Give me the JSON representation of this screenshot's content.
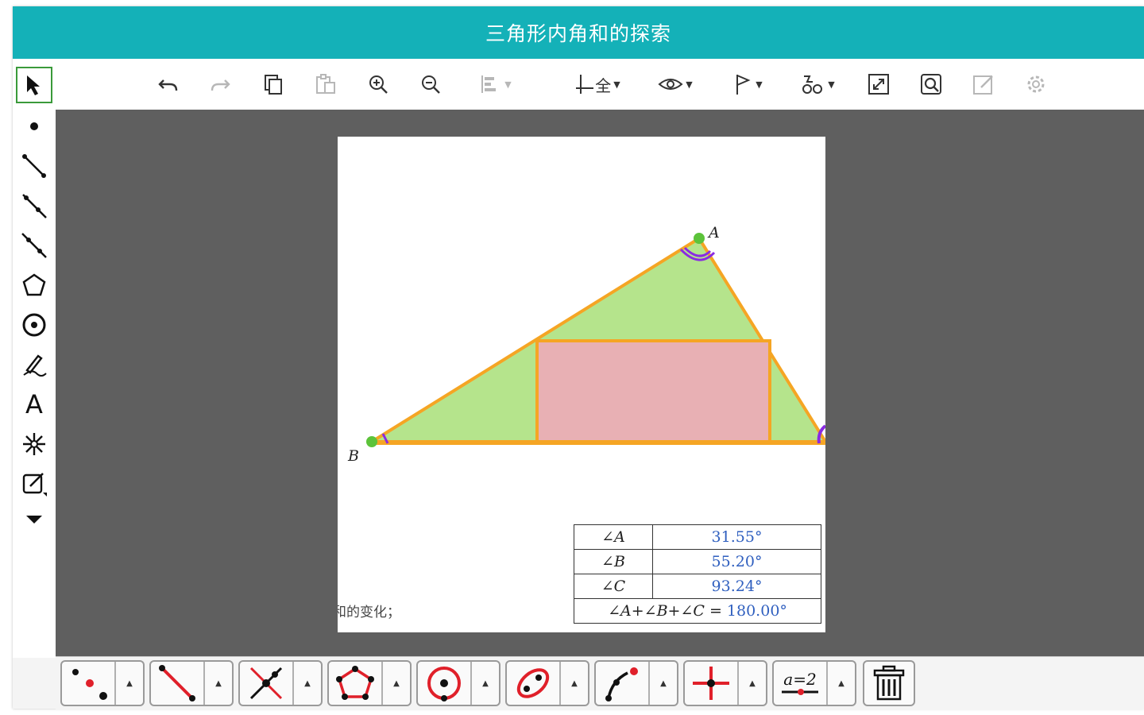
{
  "window": {
    "title": "三角形内角和的探索"
  },
  "toolbar": {
    "items": [
      {
        "name": "undo-button",
        "icon": "undo-icon"
      },
      {
        "name": "redo-button",
        "icon": "redo-icon"
      },
      {
        "name": "copy-button",
        "icon": "copy-icon"
      },
      {
        "name": "paste-button",
        "icon": "paste-icon"
      },
      {
        "name": "zoom-in-button",
        "icon": "zoom-in-icon"
      },
      {
        "name": "zoom-out-button",
        "icon": "zoom-out-icon"
      },
      {
        "name": "align-button",
        "icon": "align-icon"
      },
      {
        "name": "coordinate-button",
        "icon": "coordinate-icon",
        "label": "全"
      },
      {
        "name": "visibility-button",
        "icon": "eye-icon"
      },
      {
        "name": "flag-button",
        "icon": "flag-icon"
      },
      {
        "name": "animation-button",
        "icon": "animation-icon"
      },
      {
        "name": "fullscreen-button",
        "icon": "fullscreen-icon"
      },
      {
        "name": "search-button",
        "icon": "search-icon"
      },
      {
        "name": "edit-button",
        "icon": "edit-icon"
      },
      {
        "name": "settings-button",
        "icon": "gear-icon"
      }
    ]
  },
  "left_tools": [
    "select-arrow-icon",
    "point-icon",
    "segment-icon",
    "ray-icon",
    "line-icon",
    "polygon-icon",
    "circle-icon",
    "pen-icon",
    "text-icon",
    "burst-icon",
    "edit-area-icon",
    "more-chevron-icon"
  ],
  "left_text_tool": {
    "label": "A"
  },
  "canvas": {
    "points": [
      {
        "label": "A"
      },
      {
        "label": "B"
      }
    ],
    "colors": {
      "triangle_fill": "#b5e48c",
      "rectangle_fill": "#e8b0b4",
      "edge": "#f5a524",
      "point": "#5cc33a",
      "angle_mark": "#8a2be2"
    },
    "angle_table": {
      "rows": [
        {
          "label": "∠A",
          "value": "31.55°"
        },
        {
          "label": "∠B",
          "value": "55.20°"
        },
        {
          "label": "∠C",
          "value": "93.24°"
        }
      ],
      "sum_label": "∠A+∠B+∠C =",
      "sum_value": "180.00°"
    },
    "partial_text": "和的变化；"
  },
  "bottom_tools": [
    {
      "name": "point-group",
      "icon": "points-icon"
    },
    {
      "name": "segment-group",
      "icon": "segment-icon"
    },
    {
      "name": "intersect-group",
      "icon": "intersect-icon"
    },
    {
      "name": "polygon-group",
      "icon": "polygon-icon"
    },
    {
      "name": "circle-group",
      "icon": "circle-icon"
    },
    {
      "name": "conic-group",
      "icon": "ellipse-icon"
    },
    {
      "name": "arc-group",
      "icon": "arc-icon"
    },
    {
      "name": "transform-group",
      "icon": "transform-icon"
    },
    {
      "name": "measure-group",
      "icon": "slider-icon",
      "label": "a=2"
    },
    {
      "name": "delete-button",
      "icon": "trash-icon"
    }
  ]
}
